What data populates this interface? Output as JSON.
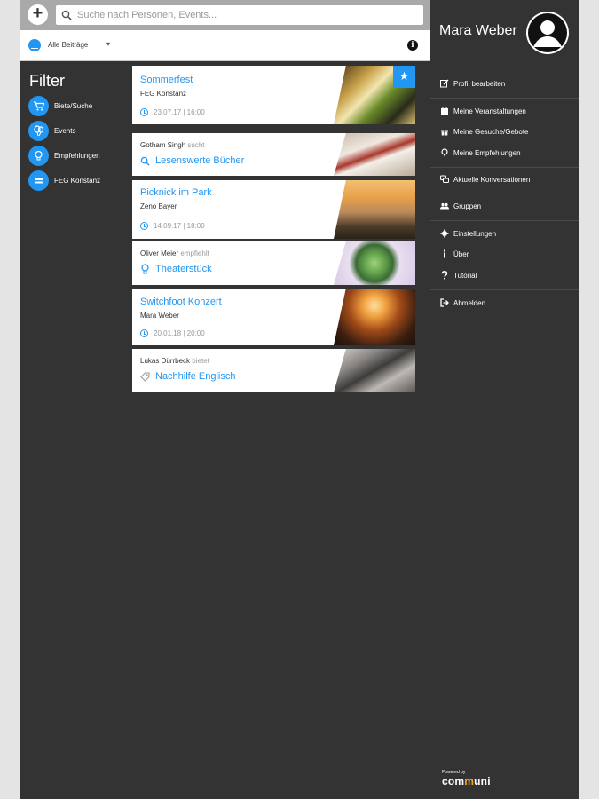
{
  "header": {
    "add_label": "+",
    "search_placeholder": "Suche nach Personen, Events..."
  },
  "filterbar": {
    "selected": "Alle Beiträge",
    "caret": "▾",
    "info_label": "i"
  },
  "filter": {
    "title": "Filter",
    "items": [
      {
        "label": "Biete/Suche",
        "icon": "cart-icon"
      },
      {
        "label": "Events",
        "icon": "balloon-icon"
      },
      {
        "label": "Empfehlungen",
        "icon": "lightbulb-icon"
      },
      {
        "label": "FEG Konstanz",
        "icon": "group-icon"
      }
    ]
  },
  "feed": [
    {
      "type": "event",
      "title": "Sommerfest",
      "sub": "FEG Konstanz",
      "date": "23.07.17 | 16:00",
      "starred": true,
      "star": "★"
    },
    {
      "type": "post",
      "author": "Gotham Singh",
      "verb": "sucht",
      "title": "Lesenswerte Bücher",
      "icon": "search-icon"
    },
    {
      "type": "event",
      "title": "Picknick im Park",
      "sub": "Zeno Bayer",
      "date": "14.09.17 | 18:00"
    },
    {
      "type": "post",
      "author": "Oliver Meier",
      "verb": "empfiehlt",
      "title": "Theaterstück",
      "icon": "lightbulb-icon"
    },
    {
      "type": "event",
      "title": "Switchfoot Konzert",
      "sub": "Mara Weber",
      "date": "20.01.18 | 20:00"
    },
    {
      "type": "post",
      "author": "Lukas Dürrbeck",
      "verb": "bietet",
      "title": "Nachhilfe Englisch",
      "icon": "tag-icon"
    }
  ],
  "menu": {
    "user_name": "Mara Weber",
    "items": [
      {
        "label": "Profil bearbeiten",
        "icon": "edit-icon"
      },
      {
        "label": "Meine Veranstaltungen",
        "icon": "calendar-icon"
      },
      {
        "label": "Meine Gesuche/Gebote",
        "icon": "gift-icon"
      },
      {
        "label": "Meine Empfehlungen",
        "icon": "pin-icon"
      },
      {
        "label": "Aktuelle Konversationen",
        "icon": "chat-icon"
      },
      {
        "label": "Gruppen",
        "icon": "users-icon"
      },
      {
        "label": "Einstellungen",
        "icon": "gear-icon"
      },
      {
        "label": "Über",
        "icon": "info-icon"
      },
      {
        "label": "Tutorial",
        "icon": "question-icon"
      },
      {
        "label": "Abmelden",
        "icon": "logout-icon"
      }
    ]
  },
  "footer": {
    "powered": "Powered by",
    "brand_a": "com",
    "brand_m": "m",
    "brand_b": "uni"
  },
  "colors": {
    "accent": "#2196f3",
    "panel": "#333333",
    "brand_accent": "#f5a623"
  }
}
